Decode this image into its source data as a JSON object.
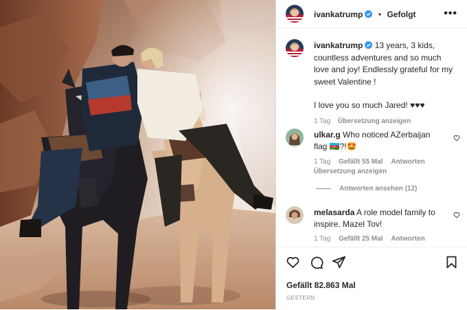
{
  "post": {
    "author": "ivankatrump",
    "follow_state": "Gefolgt",
    "header_separator": "•",
    "caption": {
      "username": "ivankatrump",
      "text": "13 years, 3 kids, countless adventures and so much love and joy! Endlessly grateful for my sweet Valentine !",
      "text2": "I love you so much Jared! ♥♥♥",
      "time": "1 Tag",
      "translate": "Übersetzung anzeigen"
    },
    "comments": [
      {
        "username": "ulkar.g",
        "text": "Who noticed AZerbaijan flag 🇦🇿?!🤩",
        "time": "1 Tag",
        "likes": "Gefällt 55 Mal",
        "reply": "Antworten",
        "translate": "Übersetzung anzeigen",
        "view_replies": "Antworten ansehen (12)"
      },
      {
        "username": "melasarda",
        "text": "A role model family to inspire. Mazel Tov!",
        "time": "1 Tag",
        "likes": "Gefällt 25 Mal",
        "reply": "Antworten"
      }
    ],
    "likes_count": "Gefällt 82.863 Mal",
    "date_label": "GESTERN",
    "more_label": "•••"
  },
  "colors": {
    "verified_blue": "#3897f0",
    "text": "#262626",
    "secondary": "#8e8e8e",
    "border": "#dbdbdb"
  },
  "icons": [
    "more-options-icon",
    "verified-badge-icon",
    "heart-icon",
    "comment-icon",
    "share-icon",
    "bookmark-icon"
  ]
}
